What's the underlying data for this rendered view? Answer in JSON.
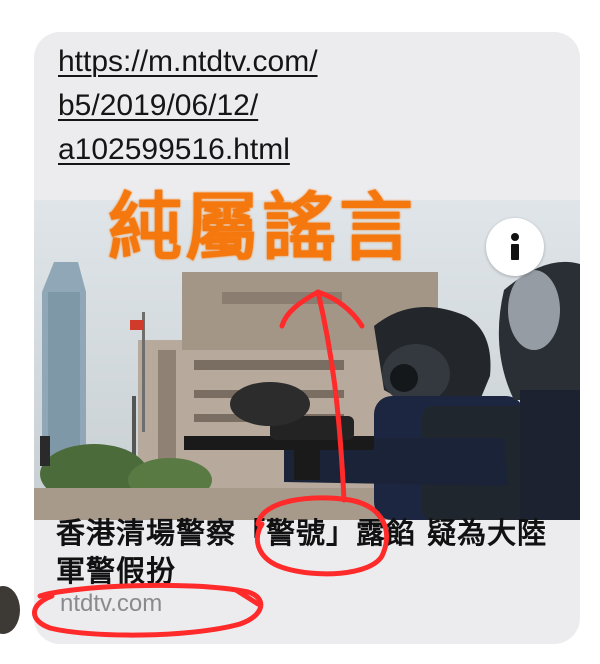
{
  "message": {
    "link_url_lines": [
      "https://m.ntdtv.com/",
      "b5/2019/06/12/",
      "a102599516.html"
    ],
    "preview_title": "香港清場警察「警號」露餡 疑為大陸軍警假扮",
    "preview_domain": "ntdtv.com",
    "info_icon": "info-icon"
  },
  "annotation": {
    "text": "純屬謠言",
    "color": "#f5780f",
    "markup_color": "#ff2a2a"
  }
}
